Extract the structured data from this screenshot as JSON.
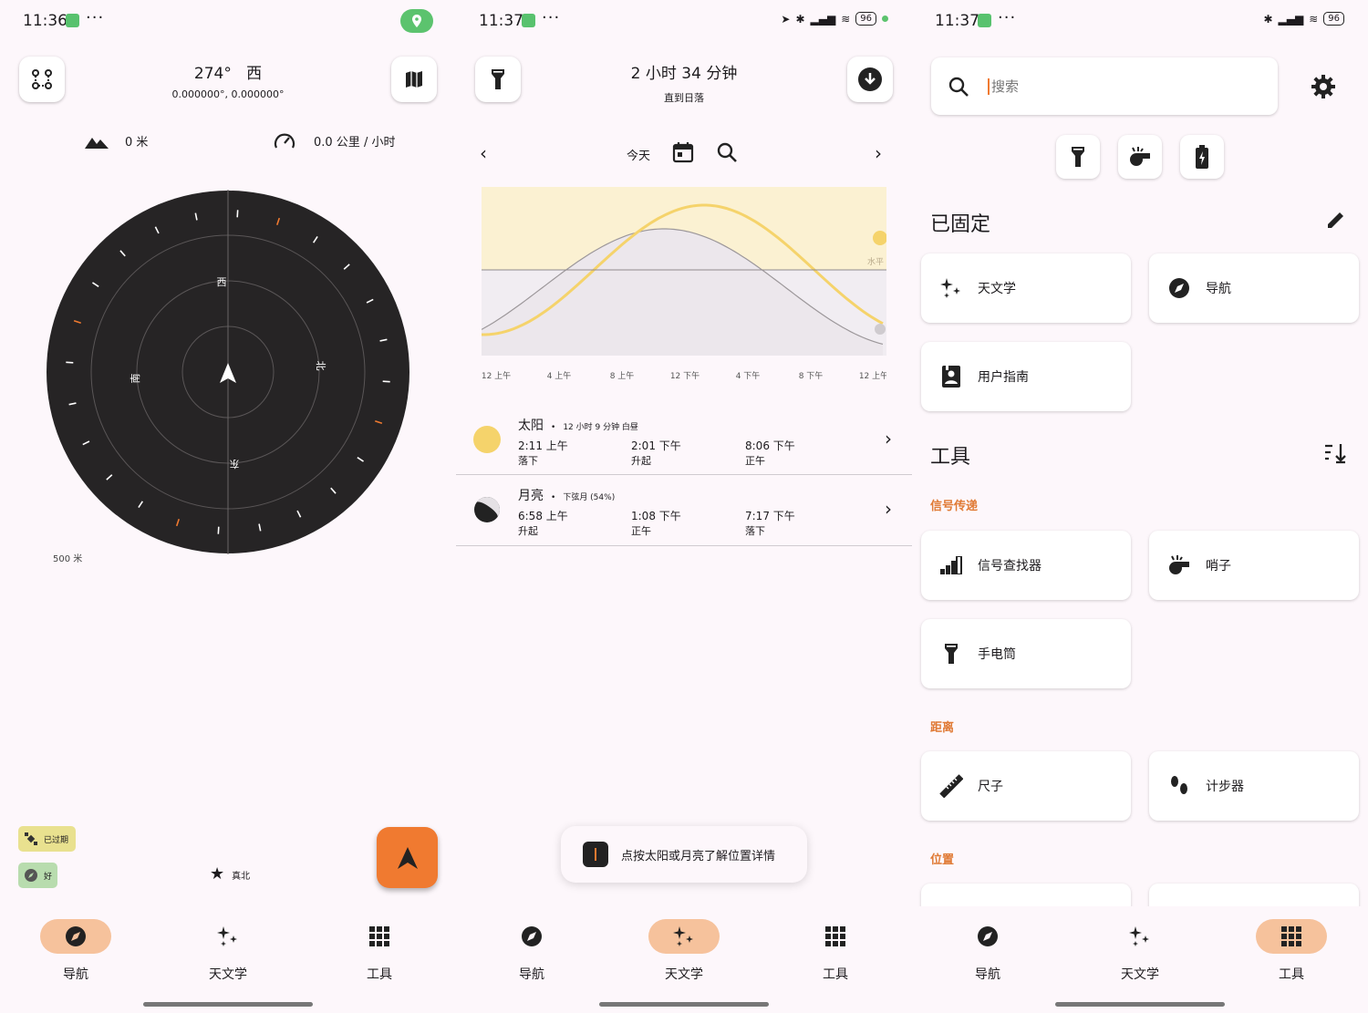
{
  "screen1": {
    "status": {
      "time": "11:36",
      "dots": "···"
    },
    "heading": {
      "degrees": "274°",
      "direction": "西"
    },
    "coords": "0.000000°, 0.000000°",
    "altitude": "0 米",
    "speed": "0.0 公里 / 小时",
    "compass": {
      "n": "北",
      "e": "东",
      "s": "南",
      "w": "西",
      "heading_deg": 274
    },
    "scale": "500 米",
    "badges": {
      "gps": "已过期",
      "compass": "好"
    },
    "true_north": "真北"
  },
  "screen2": {
    "status": {
      "time": "11:37",
      "dots": "···",
      "battery": "96"
    },
    "header": {
      "title": "2 小时 34 分钟",
      "subtitle": "直到日落"
    },
    "date_nav": {
      "today": "今天"
    },
    "chart_data": {
      "type": "line",
      "x_ticks": [
        "12 上午",
        "4 上午",
        "8 上午",
        "12 下午",
        "4 下午",
        "8 下午",
        "12 上午"
      ],
      "horizon_label": "水平",
      "series": [
        {
          "name": "太阳",
          "color": "#f5d36b"
        },
        {
          "name": "月亮",
          "color": "#9c979a"
        }
      ]
    },
    "sun": {
      "name": "太阳",
      "note": "12 小时 9 分钟 白昼",
      "events": [
        {
          "time": "2:11 上午",
          "label": "落下"
        },
        {
          "time": "2:01 下午",
          "label": "升起"
        },
        {
          "time": "8:06 下午",
          "label": "正午"
        }
      ]
    },
    "moon": {
      "name": "月亮",
      "note": "下弦月 (54%)",
      "events": [
        {
          "time": "6:58 上午",
          "label": "升起"
        },
        {
          "time": "1:08 下午",
          "label": "正午"
        },
        {
          "time": "7:17 下午",
          "label": "落下"
        }
      ]
    },
    "toast": "点按太阳或月亮了解位置详情",
    "bullet": "•"
  },
  "screen3": {
    "status": {
      "time": "11:37",
      "dots": "···",
      "battery": "96"
    },
    "search": {
      "placeholder": "搜索"
    },
    "pinned": {
      "title": "已固定",
      "items": [
        "天文学",
        "导航",
        "用户指南"
      ]
    },
    "tools": {
      "title": "工具",
      "cat_signal": "信号传递",
      "signal_items": [
        "信号查找器",
        "哨子",
        "手电筒"
      ],
      "cat_distance": "距离",
      "distance_items": [
        "尺子",
        "计步器"
      ],
      "cat_location": "位置"
    }
  },
  "nav": {
    "navigation": "导航",
    "astronomy": "天文学",
    "tools": "工具"
  },
  "colors": {
    "accent": "#f07a30",
    "sun": "#f5d36b",
    "pill": "#f6c29c",
    "dial": "#262425"
  }
}
